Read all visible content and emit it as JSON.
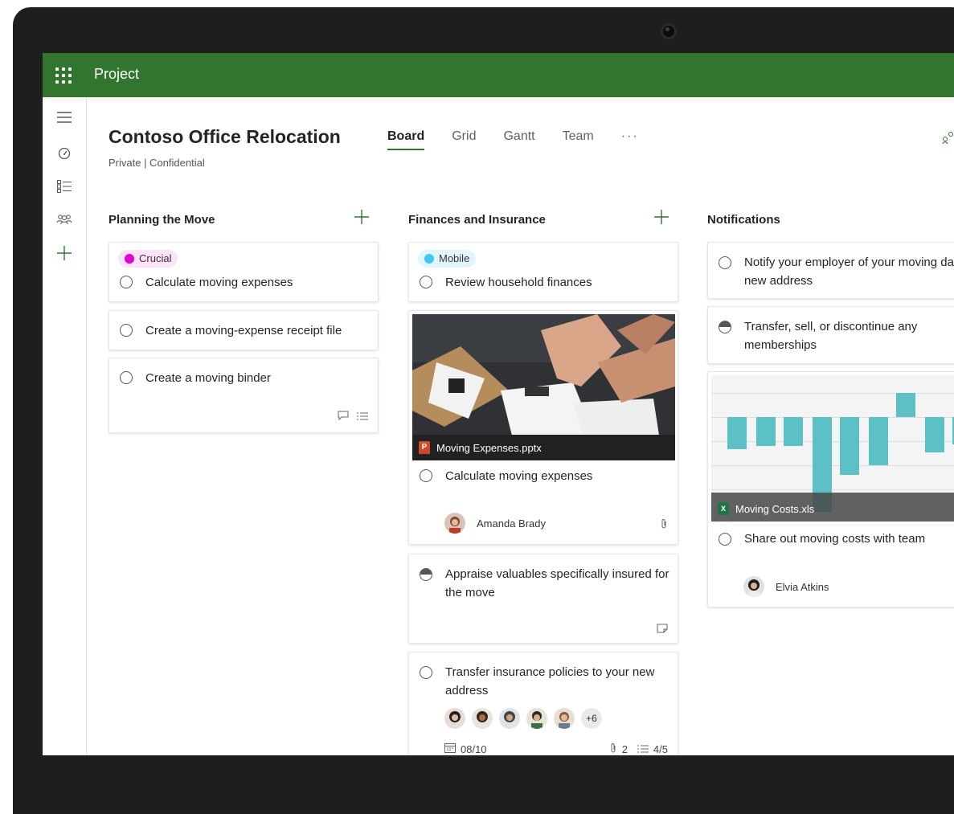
{
  "app": {
    "title": "Project"
  },
  "colors": {
    "brand": "#31752f",
    "crucial": "#e000d2",
    "mobile": "#41c7f4",
    "chart_bar": "#5cc0c7"
  },
  "rail": {
    "icons": [
      "hamburger-icon",
      "dashboard-icon",
      "task-list-icon",
      "people-icon",
      "add-icon"
    ]
  },
  "plan": {
    "name": "Contoso Office Relocation",
    "privacy": "Private | Confidential"
  },
  "tabs": [
    {
      "label": "Board",
      "active": true
    },
    {
      "label": "Grid",
      "active": false
    },
    {
      "label": "Gantt",
      "active": false
    },
    {
      "label": "Team",
      "active": false
    },
    {
      "label": "···",
      "active": false
    }
  ],
  "buckets": [
    {
      "name": "Planning the Move",
      "tasks": [
        {
          "label": "Crucial",
          "title": "Calculate moving expenses"
        },
        {
          "title": "Create a moving-expense receipt file"
        },
        {
          "title": "Create a moving binder"
        }
      ]
    },
    {
      "name": "Finances and Insurance",
      "tasks": [
        {
          "label": "Mobile",
          "title": "Review household finances"
        },
        {
          "attachment": "Moving Expenses.pptx",
          "title": "Calculate moving expenses",
          "assignee": "Amanda Brady"
        },
        {
          "title": "Appraise valuables specifically insured for the move",
          "progress": 0.5
        },
        {
          "title": "Transfer insurance policies to your new address",
          "extra_assignees": "+6",
          "due": "08/10",
          "attachments": "2",
          "checklist": "4/5"
        }
      ]
    },
    {
      "name": "Notifications",
      "tasks": [
        {
          "title": "Notify your employer of your moving dates and new address"
        },
        {
          "title": "Transfer, sell, or discontinue any memberships",
          "progress": 0.5
        },
        {
          "attachment": "Moving Costs.xls",
          "title": "Share out moving costs with team",
          "assignee": "Elvia Atkins"
        }
      ]
    }
  ]
}
